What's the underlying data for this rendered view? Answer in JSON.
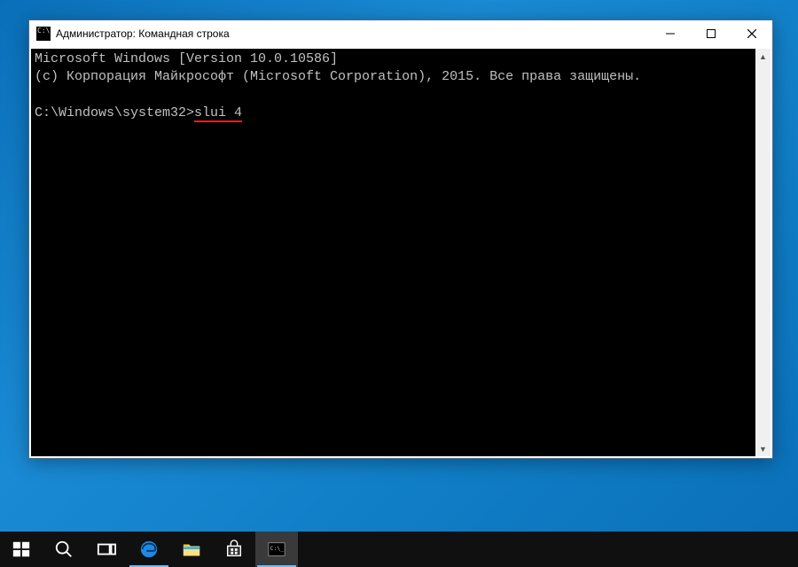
{
  "window": {
    "title": "Администратор: Командная строка"
  },
  "console": {
    "line1": "Microsoft Windows [Version 10.0.10586]",
    "line2": "(c) Корпорация Майкрософт (Microsoft Corporation), 2015. Все права защищены.",
    "prompt": "C:\\Windows\\system32>",
    "command": "slui 4"
  }
}
